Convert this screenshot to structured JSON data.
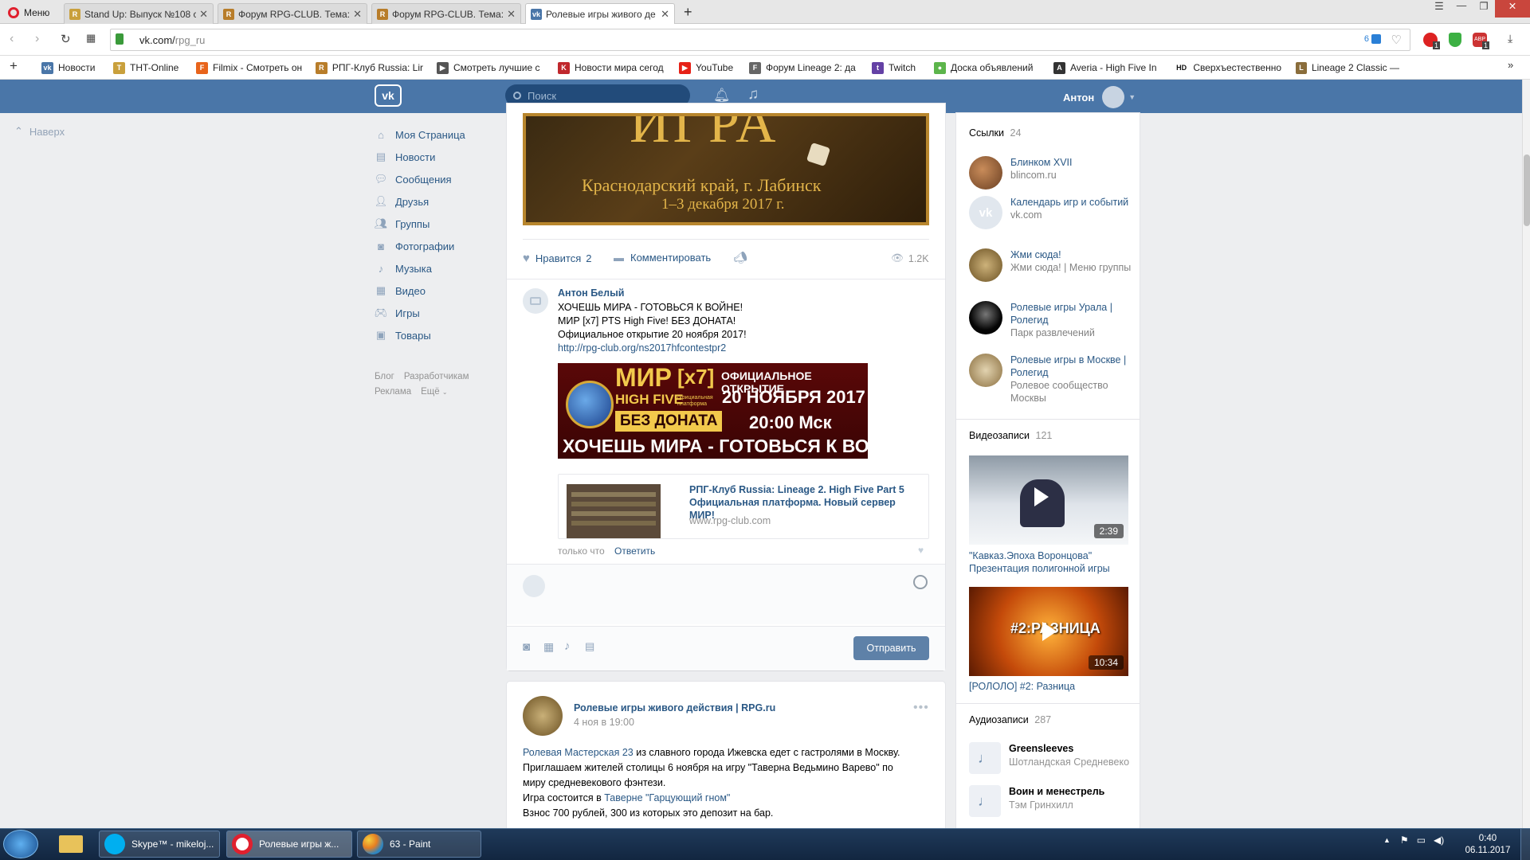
{
  "browser": {
    "menu_label": "Меню",
    "tabs": [
      {
        "title": "Stand Up: Выпуск №108 с"
      },
      {
        "title": "Форум RPG-CLUB. Тема: I"
      },
      {
        "title": "Форум RPG-CLUB. Тема: I"
      },
      {
        "title": "Ролевые игры живого де"
      }
    ],
    "url_host": "vk.com/",
    "url_path": "rpg_ru",
    "adblock_count": "6",
    "bookmarks": [
      "Новости",
      "THT-Online",
      "Filmix - Смотреть он",
      "РПГ-Клуб Russia: Lir",
      "Смотреть лучшие с",
      "Новости мира сегод",
      "YouTube",
      "Форум Lineage 2: да",
      "Twitch",
      "Доска объявлений",
      "Averia - High Five In",
      "Сверхъестественно",
      "Lineage 2 Classic —"
    ],
    "bookmark_hd": "HD",
    "ext_badges": [
      "1",
      "1"
    ]
  },
  "vk": {
    "search_placeholder": "Поиск",
    "user_name": "Антон",
    "back_to_top": "Наверх",
    "nav": [
      "Моя Страница",
      "Новости",
      "Сообщения",
      "Друзья",
      "Группы",
      "Фотографии",
      "Музыка",
      "Видео",
      "Игры",
      "Товары"
    ],
    "footer_links": [
      "Блог",
      "Разработчикам",
      "Реклама",
      "Ещё"
    ],
    "post1": {
      "banner_text_big": "ИГРА",
      "banner_text_place": "Краснодарский край, г. Лабинск",
      "banner_text_date": "1–3 декабря 2017 г.",
      "like_label": "Нравится",
      "like_count": "2",
      "comment_label": "Комментировать",
      "views": "1.2K"
    },
    "comment": {
      "author": "Антон Белый",
      "lines": [
        "ХОЧЕШЬ МИРА - ГОТОВЬСЯ К ВОЙНЕ!",
        "МИР [x7] PTS High Five! БЕЗ ДОНАТА!",
        "Официальное открытие 20 ноября 2017!"
      ],
      "link": "http://rpg-club.org/ns2017hfcontestpr2",
      "banner": {
        "mir": "МИР",
        "x7": "[x7]",
        "opening": "ОФИЦИАЛЬНОЕ ОТКРЫТИЕ",
        "hf": "HIGH FIVE",
        "platform": "официальная платформа",
        "date": "20 НОЯБРЯ 2017",
        "no_donat": "БЕЗ ДОНАТА",
        "time": "20:00 Мск",
        "slogan": "ХОЧЕШЬ МИРА - ГОТОВЬСЯ К ВОЙНЕ"
      },
      "snippet_title": "РПГ-Клуб Russia: Lineage 2. High Five Part 5 Официальная платформа. Новый сервер МИР!",
      "snippet_domain": "www.rpg-club.com",
      "time": "только что",
      "reply": "Ответить"
    },
    "composer": {
      "send_label": "Отправить"
    },
    "post2": {
      "author": "Ролевые игры живого действия | RPG.ru",
      "date": "4 ноя в 19:00",
      "link1": "Ролевая Мастерская 23",
      "text1": " из славного города Ижевска едет с гастролями в Москву.",
      "text2": "Приглашаем жителей столицы 6 ноября на игру \"Таверна Ведьмино Варево\" по",
      "text3": "миру средневекового фэнтези.",
      "text4_pre": "Игра состоится в ",
      "text4_link": "Таверне \"Гарцующий гном\"",
      "text5": "Взнос 700 рублей, 300 из которых это депозит на бар."
    },
    "links_block": {
      "title": "Ссылки",
      "count": "24",
      "items": [
        {
          "title": "Блинком XVII",
          "sub": "blincom.ru"
        },
        {
          "title": "Календарь игр и событий",
          "sub": "vk.com"
        },
        {
          "title": "Жми сюда!",
          "sub": "Жми сюда! | Меню группы"
        },
        {
          "title": "Ролевые игры Урала | Ролегид",
          "sub": "Парк развлечений"
        },
        {
          "title": "Ролевые игры в Москве | Ролегид",
          "sub": "Ролевое сообщество Москвы"
        }
      ]
    },
    "videos_block": {
      "title": "Видеозаписи",
      "count": "121",
      "items": [
        {
          "title": "\"Кавказ.Эпоха Воронцова\" Презентация полигонной игры",
          "duration": "2:39"
        },
        {
          "title": "[РОЛОЛО] #2: Разница",
          "duration": "10:34",
          "overlay": "#2:РАЗНИЦА"
        }
      ]
    },
    "audio_block": {
      "title": "Аудиозаписи",
      "count": "287",
      "items": [
        {
          "title": "Greensleeves",
          "artist": "Шотландская Средневеко"
        },
        {
          "title": "Воин и менестрель",
          "artist": "Тэм Гринхилл"
        }
      ]
    }
  },
  "taskbar": {
    "items": [
      {
        "label": "Skype™ - mikeloj..."
      },
      {
        "label": "Ролевые игры ж..."
      },
      {
        "label": "63 - Paint"
      }
    ],
    "time": "0:40",
    "date": "06.11.2017"
  }
}
